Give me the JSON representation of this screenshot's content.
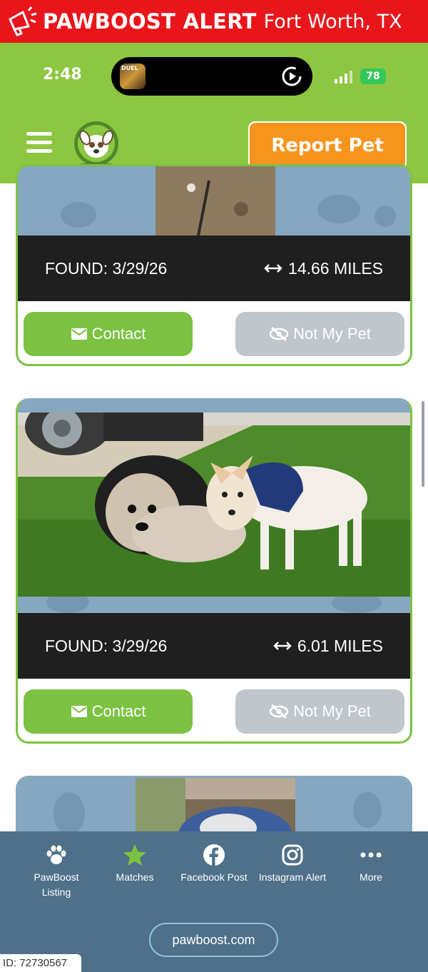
{
  "alert": {
    "brand": "PAWBOOST ALERT",
    "city": "Fort Worth, TX"
  },
  "status": {
    "time": "2:48",
    "app_thumb_text": "DUEL",
    "battery": "78"
  },
  "header": {
    "report_label": "Report Pet"
  },
  "matches": [
    {
      "found": "FOUND: 3/29/26",
      "distance": "14.66 MILES",
      "contact": "Contact",
      "not_my_pet": "Not My Pet"
    },
    {
      "found": "FOUND: 3/29/26",
      "distance": "6.01 MILES",
      "contact": "Contact",
      "not_my_pet": "Not My Pet"
    }
  ],
  "nav": {
    "items": [
      {
        "label": "PawBoost Listing",
        "icon": "paw-icon"
      },
      {
        "label": "Matches",
        "icon": "star-icon"
      },
      {
        "label": "Facebook Post",
        "icon": "facebook-icon"
      },
      {
        "label": "Instagram Alert",
        "icon": "instagram-icon"
      },
      {
        "label": "More",
        "icon": "more-dots-icon"
      }
    ],
    "site": "pawboost.com"
  },
  "watermark_id": "ID: 72730567",
  "colors": {
    "alert_red": "#e8161b",
    "brand_green": "#8dc641",
    "orange": "#f7941d",
    "nav_blue": "#4e7089",
    "card_dark": "#1f1f1f"
  }
}
